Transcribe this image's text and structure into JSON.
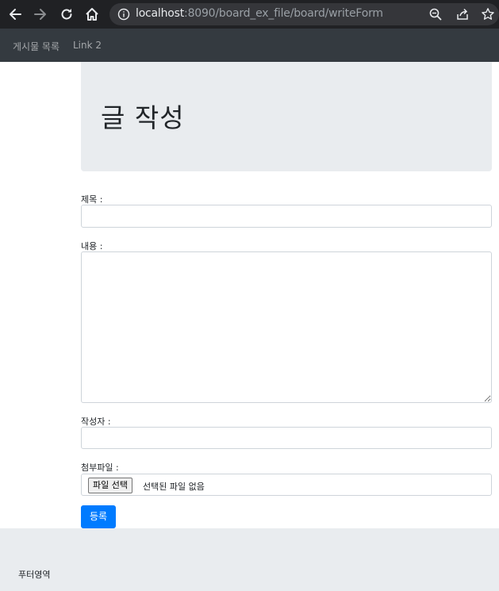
{
  "browser": {
    "url_host": "localhost",
    "url_path": ":8090/board_ex_file/board/writeForm",
    "icons": [
      "back-arrow-icon",
      "forward-arrow-icon",
      "reload-icon",
      "home-icon",
      "info-icon",
      "zoom-icon",
      "share-icon",
      "star-icon"
    ]
  },
  "navbar": {
    "links": [
      "게시물 목록",
      "Link 2"
    ]
  },
  "jumbotron": {
    "title": "글 작성"
  },
  "form": {
    "title_label": "제목 :",
    "title_value": "",
    "content_label": "내용 :",
    "content_value": "",
    "writer_label": "작성자 :",
    "writer_value": "",
    "file_label": "첨부파일 :",
    "file_button": "파일 선택",
    "file_status": "선택된 파일 없음",
    "submit_label": "등록"
  },
  "footer": {
    "text": "푸터영역"
  },
  "colors": {
    "browser_bg": "#202124",
    "navbar_bg": "#343a40",
    "jumbotron_bg": "#e9ecef",
    "primary": "#007bff"
  }
}
